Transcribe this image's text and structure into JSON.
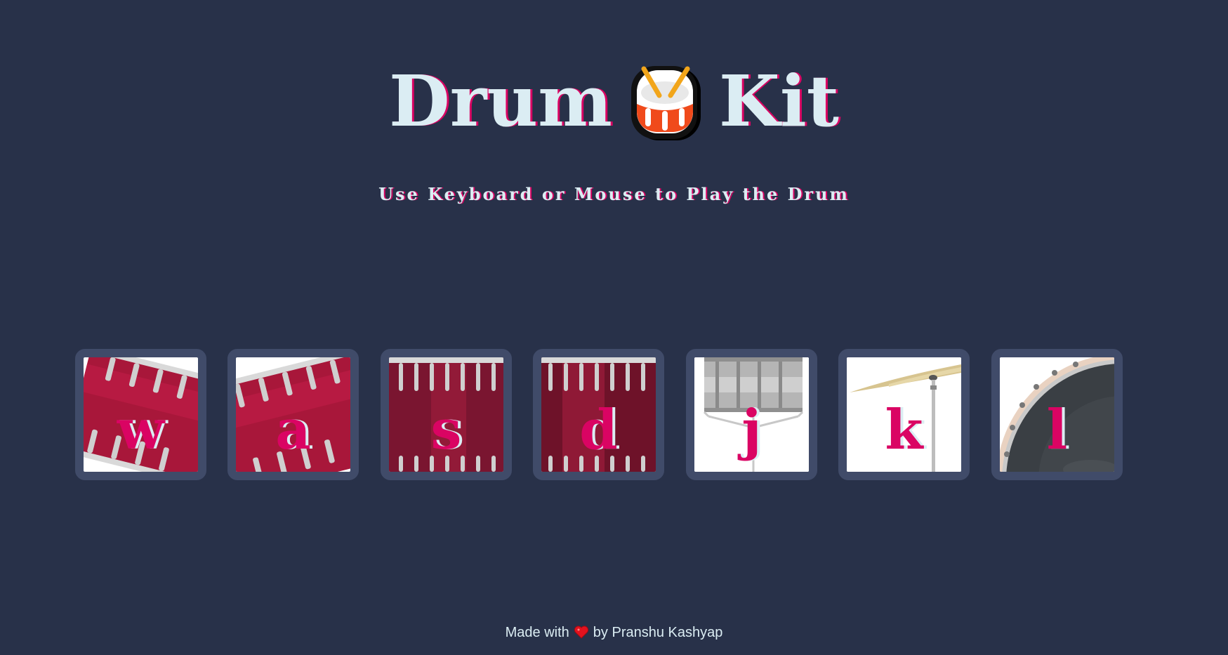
{
  "header": {
    "title_left": "Drum",
    "title_icon": "drum-emoji",
    "title_right": "Kit",
    "subtitle": "Use Keyboard or Mouse to Play the Drum"
  },
  "pads": [
    {
      "key": "w",
      "image": "tom-drum-tilted-left"
    },
    {
      "key": "a",
      "image": "tom-drum-tilted-right"
    },
    {
      "key": "s",
      "image": "snare-drum"
    },
    {
      "key": "d",
      "image": "snare-drum"
    },
    {
      "key": "j",
      "image": "silver-snare-on-stand"
    },
    {
      "key": "k",
      "image": "crash-cymbal"
    },
    {
      "key": "l",
      "image": "bass-drum"
    }
  ],
  "footer": {
    "prefix": "Made with",
    "icon": "heart-icon",
    "suffix": "by Pranshu Kashyap"
  },
  "colors": {
    "background": "#283149",
    "pad_border": "#404b69",
    "accent": "#da0463",
    "text": "#dbedf3"
  }
}
